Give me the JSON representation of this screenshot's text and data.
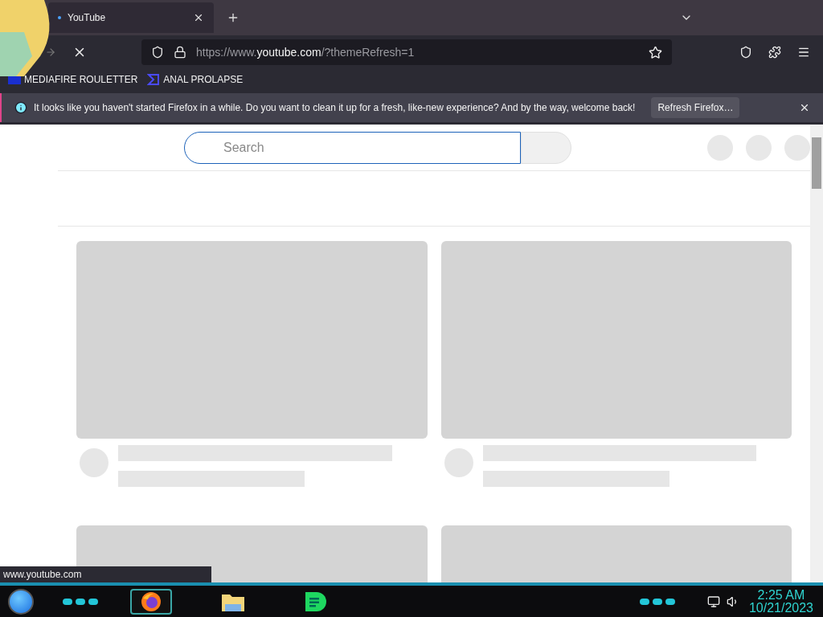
{
  "browser": {
    "tabs": [
      {
        "title": "YouTube",
        "selected": true,
        "loading": true
      }
    ],
    "address": {
      "prefix": "https://www.",
      "domain": "youtube.com",
      "path": "/?themeRefresh=1"
    },
    "bookmarks": [
      {
        "label": "MEDIAFIRE ROULETTER",
        "kind": "t"
      },
      {
        "label": "ANAL PROLAPSE",
        "kind": "sigma"
      }
    ],
    "notification": {
      "message": "It looks like you haven't started Firefox in a while. Do you want to clean it up for a fresh, like-new experience? And by the way, welcome back!",
      "button": "Refresh Firefox…"
    },
    "status_url": "www.youtube.com"
  },
  "page": {
    "search": {
      "placeholder": "Search"
    }
  },
  "taskbar": {
    "apps": [
      {
        "kind": "firefox",
        "selected": true
      },
      {
        "kind": "folder",
        "selected": false
      },
      {
        "kind": "spotify",
        "selected": false
      }
    ],
    "time": "2:25 AM",
    "date": "10/21/2023"
  }
}
